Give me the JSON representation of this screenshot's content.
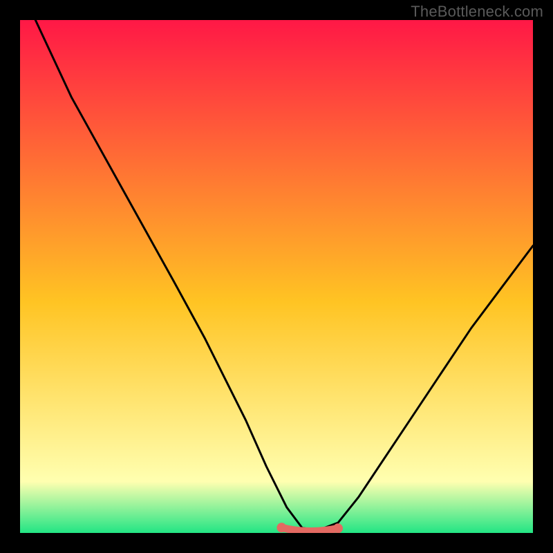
{
  "watermark": "TheBottleneck.com",
  "colors": {
    "bg": "#000000",
    "grad_top": "#ff1846",
    "grad_mid": "#ffc423",
    "grad_low": "#ffffb0",
    "grad_bottom": "#22e584",
    "curve": "#000000",
    "highlight": "#e36a62"
  },
  "chart_data": {
    "type": "line",
    "title": "",
    "xlabel": "",
    "ylabel": "",
    "xlim": [
      0,
      100
    ],
    "ylim": [
      0,
      100
    ],
    "series": [
      {
        "name": "bottleneck-curve",
        "x": [
          3,
          10,
          20,
          30,
          36,
          40,
          44,
          48,
          52,
          55,
          58,
          62,
          66,
          70,
          76,
          82,
          88,
          94,
          100
        ],
        "y": [
          100,
          85,
          67,
          49,
          38,
          30,
          22,
          13,
          5,
          1,
          0.5,
          2,
          7,
          13,
          22,
          31,
          40,
          48,
          56
        ]
      }
    ],
    "annotations": [
      {
        "name": "optimal-zone",
        "xrange": [
          51,
          62
        ],
        "y": 0.5
      }
    ]
  }
}
